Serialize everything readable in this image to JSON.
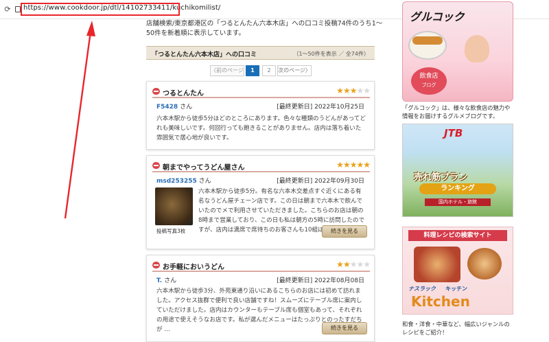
{
  "browser": {
    "url": "https://www.cookdoor.jp/dtl/14102733411/kuchikomilist/"
  },
  "intro": "店舗検索/東京都港区の「つるとんたん六本木店」への口コミ投稿74件のうち1～50件を新着順に表示しています。",
  "review_header": {
    "title": "「つるとんたん六本木店」への口コミ",
    "count": "（1～50件を表示 ／ 全74件）"
  },
  "pager": {
    "prev": "〈前のページ",
    "page1": "1",
    "page2": "2",
    "next": "次のページ〉"
  },
  "reviews": [
    {
      "shop": "つるとんたん",
      "rating": 3,
      "user": "F5428",
      "san": "さん",
      "date": "[最終更新日] 2022年10月25日",
      "text": "六本木駅から徒歩5分ほどのところにあります。色々な種類のうどんがあってどれも美味しいです。何回行っても飽きることがありません。店内は落ち着いた雰囲気で居心地が良いです。"
    },
    {
      "shop": "朝までやってうどん屋さん",
      "rating": 5,
      "user": "msd253255",
      "san": "さん",
      "date": "[最終更新日] 2022年09月30日",
      "text": "六本木駅から徒歩5分。有名な六本木交差点すぐ近くにある有名なうどん屋チェーン店です。この日は朝まで六本木で飲んでいたのでメで利用させていただきました。こちらのお店は朝の8時まで営業しており、この日も私は朝方の5時に訪問したのですが、店内は満席で席待ちのお客さんも10組ほどいました …",
      "photo_caption": "投稿写真3枚",
      "more": "続きを見る"
    },
    {
      "shop": "お手軽においうどん",
      "rating": 2,
      "user": "T.",
      "san": "さん",
      "date": "[最終更新日] 2022年08月08日",
      "text": "六本木駅から徒歩3分、外苑東通り沿いにあるこちらのお店には初めて訪れました。アクセス抜群で便利で良い店舗ですね！スムーズにテーブル席に案内していただけました。店内はカウンターもテーブル席も個室もあって、それぞれの用途で使えそうなお店です。私が選んだメニューはたっぷりとのったすだちが …",
      "more": "続きを見る"
    }
  ],
  "sidebar": {
    "ad1": {
      "logo": "グルコック",
      "badge1": "飲食店",
      "badge2": "ブログ",
      "caption": "「グルコック」は、様々な飲食店の魅力や情報をお届けするグルメブログです。"
    },
    "ad2": {
      "logo": "JTB",
      "line1": "売れ筋プラン",
      "line2": "ランキング",
      "line3": "国内ホテル・旅館"
    },
    "ad3": {
      "title": "料理レシピの検索サイト",
      "brand_small": "ナスラック",
      "brand_mid": "キッチン",
      "brand_big": "Kitchen",
      "caption": "和食・洋食・中華など、幅広いジャンルのレシピをご紹介！"
    }
  },
  "colors": {
    "accent_blue": "#1a6eb8",
    "annotation_red": "#e8262b",
    "star": "#e8a21a"
  }
}
